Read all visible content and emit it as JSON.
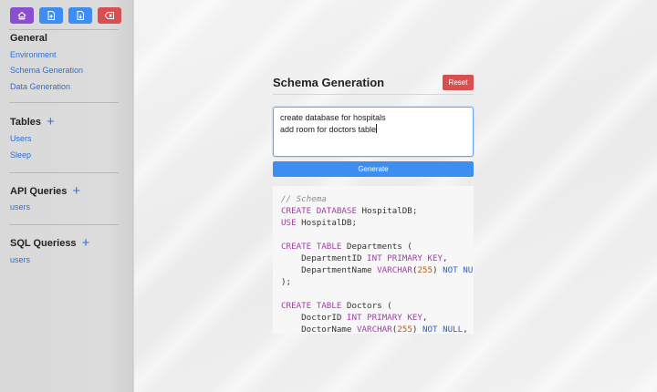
{
  "sidebar": {
    "toolbar": [
      {
        "icon": "home-icon",
        "color": "#8a4fd0"
      },
      {
        "icon": "file-add-icon",
        "color": "#3d8ef0"
      },
      {
        "icon": "file-download-icon",
        "color": "#3d8ef0"
      },
      {
        "icon": "backspace-icon",
        "color": "#d84f4f"
      }
    ],
    "general": {
      "title": "General",
      "items": [
        "Environment",
        "Schema Generation",
        "Data Generation"
      ]
    },
    "tables": {
      "title": "Tables",
      "plus": "+",
      "items": [
        "Users",
        "Sleep"
      ]
    },
    "api": {
      "title": "API Queries",
      "plus": "+",
      "items": [
        "users"
      ]
    },
    "sql": {
      "title": "SQL Queriess",
      "plus": "+",
      "items": [
        "users"
      ]
    }
  },
  "main": {
    "title": "Schema Generation",
    "reset_label": "Reset",
    "prompt_lines": [
      "create database for hospitals",
      "add room for doctors table"
    ],
    "generate_label": "Generate",
    "code_lines": [
      [
        {
          "t": "// Schema",
          "c": "cm"
        }
      ],
      [
        {
          "t": "CREATE DATABASE",
          "c": "kw"
        },
        {
          "t": " HospitalDB;",
          "c": "pl"
        }
      ],
      [
        {
          "t": "USE",
          "c": "kw"
        },
        {
          "t": " HospitalDB;",
          "c": "pl"
        }
      ],
      [],
      [
        {
          "t": "CREATE TABLE",
          "c": "kw"
        },
        {
          "t": " Departments (",
          "c": "pl"
        }
      ],
      [
        {
          "t": "    DepartmentID ",
          "c": "pl"
        },
        {
          "t": "INT PRIMARY KEY",
          "c": "kw"
        },
        {
          "t": ",",
          "c": "pl"
        }
      ],
      [
        {
          "t": "    DepartmentName ",
          "c": "pl"
        },
        {
          "t": "VARCHAR",
          "c": "kw"
        },
        {
          "t": "(",
          "c": "pl"
        },
        {
          "t": "255",
          "c": "num"
        },
        {
          "t": ") ",
          "c": "pl"
        },
        {
          "t": "NOT NULL",
          "c": "ty"
        }
      ],
      [
        {
          "t": ");",
          "c": "pl"
        }
      ],
      [],
      [
        {
          "t": "CREATE TABLE",
          "c": "kw"
        },
        {
          "t": " Doctors (",
          "c": "pl"
        }
      ],
      [
        {
          "t": "    DoctorID ",
          "c": "pl"
        },
        {
          "t": "INT PRIMARY KEY",
          "c": "kw"
        },
        {
          "t": ",",
          "c": "pl"
        }
      ],
      [
        {
          "t": "    DoctorName ",
          "c": "pl"
        },
        {
          "t": "VARCHAR",
          "c": "kw"
        },
        {
          "t": "(",
          "c": "pl"
        },
        {
          "t": "255",
          "c": "num"
        },
        {
          "t": ") ",
          "c": "pl"
        },
        {
          "t": "NOT NULL",
          "c": "ty"
        },
        {
          "t": ",",
          "c": "pl"
        }
      ]
    ]
  }
}
